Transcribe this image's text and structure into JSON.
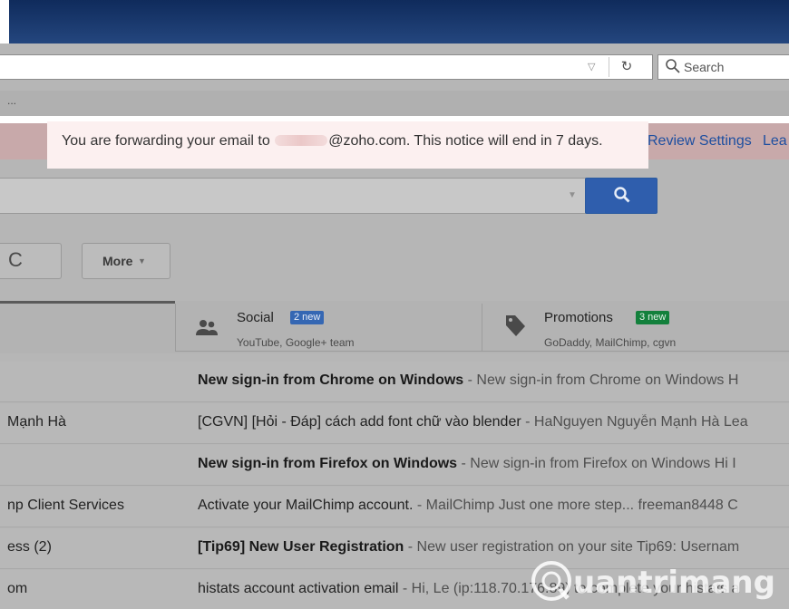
{
  "browser": {
    "search_placeholder": "Search",
    "bookmarks_overflow": "..."
  },
  "notice": {
    "prefix": "You are forwarding your email to ",
    "suffix": "@zoho.com. This notice will end in 7 days.",
    "review_link": "Review Settings",
    "learn_link": "Lea"
  },
  "toolbar": {
    "more_label": "More"
  },
  "tabs": [
    {
      "title": "",
      "badge": "",
      "subtitle": ""
    },
    {
      "title": "Social",
      "badge": "2 new",
      "subtitle": "YouTube, Google+ team"
    },
    {
      "title": "Promotions",
      "badge": "3 new",
      "subtitle": "GoDaddy, MailChimp, cgvn"
    }
  ],
  "emails": [
    {
      "sender": "",
      "subject": "New sign-in from Chrome on Windows",
      "snippet": " - New sign-in from Chrome on Windows H",
      "unread": true
    },
    {
      "sender": "Mạnh Hà",
      "subject": "[CGVN] [Hỏi - Đáp] cách add font chữ vào blender",
      "snippet": " - HaNguyen Nguyễn Mạnh Hà Lea",
      "unread": false
    },
    {
      "sender": "",
      "subject": "New sign-in from Firefox on Windows",
      "snippet": " - New sign-in from Firefox on Windows Hi I",
      "unread": true
    },
    {
      "sender": "np Client Services",
      "subject": "Activate your MailChimp account.",
      "snippet": " - MailChimp Just one more step... freeman8448 C",
      "unread": false
    },
    {
      "sender": "ess (2)",
      "subject": "[Tip69] New User Registration",
      "snippet": " - New user registration on your site Tip69: Usernam",
      "unread": true
    },
    {
      "sender": "om",
      "subject": "histats account activation email",
      "snippet": " - Hi, Le (ip:118.70.176.89) to complete your histats a",
      "unread": false
    }
  ],
  "watermark": {
    "text": "uantrimang"
  },
  "colors": {
    "notice_bg": "#fcf0f0",
    "link": "#1e4fa0",
    "search_button": "#2f5ead",
    "social_badge": "#3567b3",
    "promo_badge": "#13803c"
  }
}
